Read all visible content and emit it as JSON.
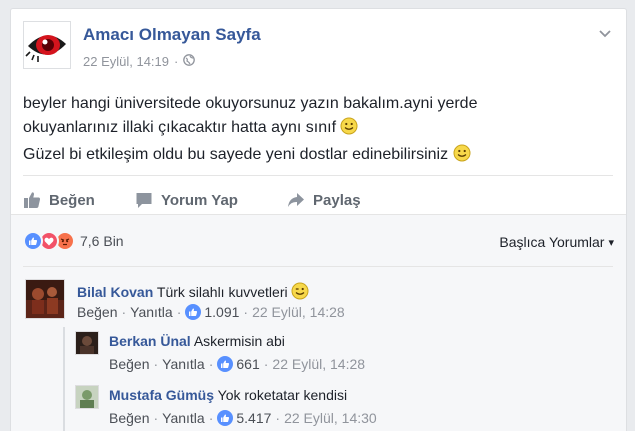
{
  "post": {
    "page_name": "Amacı Olmayan Sayfa",
    "date": "22 Eylül, 14:19",
    "meta_sep": "·",
    "lines": [
      "beyler hangi üniversitede okuyorsunuz yazın bakalım.ayni yerde",
      "okuyanlarınız illaki çıkacaktır hatta aynı sınıf",
      "Güzel bi etkileşim oldu bu sayede yeni dostlar edinebilirsiniz"
    ],
    "icons": {
      "avatar": "red-eye-logo",
      "privacy": "globe-icon",
      "options": "chevron-down-icon",
      "emoji": "smiley-emoji"
    }
  },
  "actions": {
    "like": "Beğen",
    "comment": "Yorum Yap",
    "share": "Paylaş"
  },
  "reactions": {
    "count": "7,6 Bin",
    "types": [
      "like",
      "love",
      "angry"
    ],
    "sort_label": "Başlıca Yorumlar",
    "sort_arrow": "▾"
  },
  "comments": [
    {
      "author": "Bilal Kovan",
      "text": "Türk silahlı kuvvetleri",
      "emoji": "wink-emoji",
      "like": "Beğen",
      "reply": "Yanıtla",
      "likes": "1.091",
      "time": "22 Eylül, 14:28",
      "replies": [
        {
          "author": "Berkan Ünal",
          "text": "Askermisin abi",
          "like": "Beğen",
          "reply": "Yanıtla",
          "likes": "661",
          "time": "22 Eylül, 14:28"
        },
        {
          "author": "Mustafa Gümüş",
          "text": "Yok roketatar kendisi",
          "like": "Beğen",
          "reply": "Yanıtla",
          "likes": "5.417",
          "time": "22 Eylül, 14:30"
        }
      ]
    }
  ],
  "sep": "·",
  "colors": {
    "link": "#365899",
    "like_blue": "#5890ff",
    "love_red": "#f25268",
    "angry_orange": "#f7714b",
    "emoji_yellow": "#f7d84a"
  }
}
